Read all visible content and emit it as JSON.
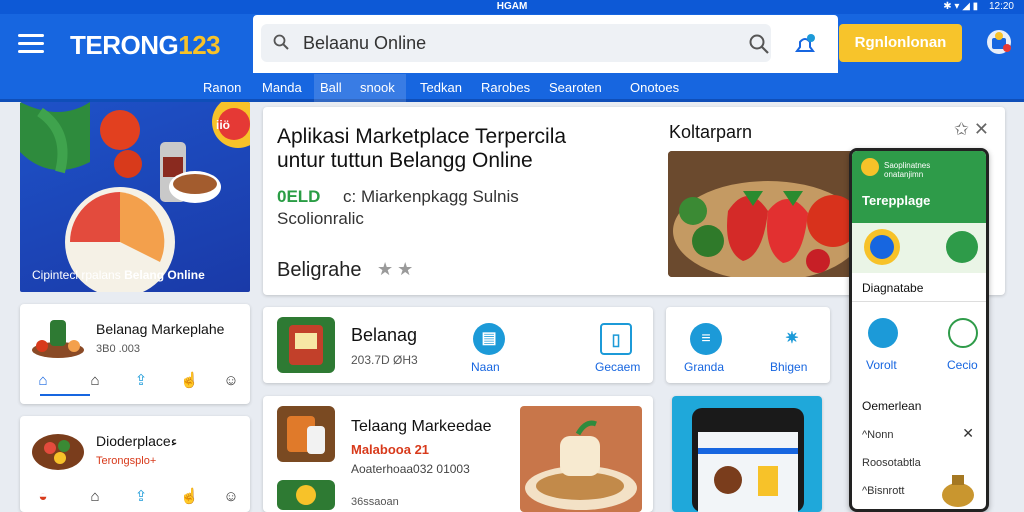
{
  "statusbar": {
    "center": "HGAM",
    "time": "12:20",
    "signal": "✱ ▾ ◢ ▮"
  },
  "appbar": {
    "logo_text": "TERONG",
    "logo_num": "123",
    "search_value": "Belaanu Online",
    "cta_label": "Rgnlonlonan"
  },
  "navbar": {
    "items": [
      "Ranon",
      "Manda",
      "Ball",
      "snook",
      "Tedkan",
      "Rarobes",
      "Searoten",
      "Onotoes"
    ]
  },
  "promo": {
    "caption_a": "Cipintecl rpalans",
    "caption_b": "Belang Online",
    "tag": "iiö"
  },
  "hero": {
    "title1": "Aplikasi Marketplace Terpercila",
    "title2": "untur tuttun Belangg Online",
    "badge": "0ELD",
    "sub1": "c: Miarkenpkagg Sulnis",
    "sub2": "Scolionralic",
    "foot": "Beligrahe",
    "stars": "★★",
    "side_title": "Koltarparn",
    "icons": "✩ ✕"
  },
  "phone": {
    "header_small": "Saoplinatnes onatanjimn",
    "header_title": "Terepplage",
    "label": "Diagnatabe",
    "opt_a": "Vorolt",
    "opt_b": "Cecio",
    "section": "Oemerlean",
    "list": [
      "^Nonn",
      "Roosotabtla",
      "^Bisnrott"
    ]
  },
  "cards": {
    "card1": {
      "title": "Belanag Markeplahe",
      "meta": "3B0 .003"
    },
    "card2": {
      "title": "Dioderplaceء",
      "meta": "Terongsplo+"
    },
    "card3": {
      "title": "Belanag",
      "meta": "203.7D ØH3"
    },
    "card4": {
      "title": "Telaang Markeedae",
      "subtitle": "Malabooa 21",
      "meta": "Aoaterhoaa032 01003",
      "foot": "36ssaoan"
    }
  },
  "row2": {
    "label_a": "Naan",
    "label_b": "Gecaem",
    "label_c": "Granda",
    "label_d": "Bhigen"
  }
}
